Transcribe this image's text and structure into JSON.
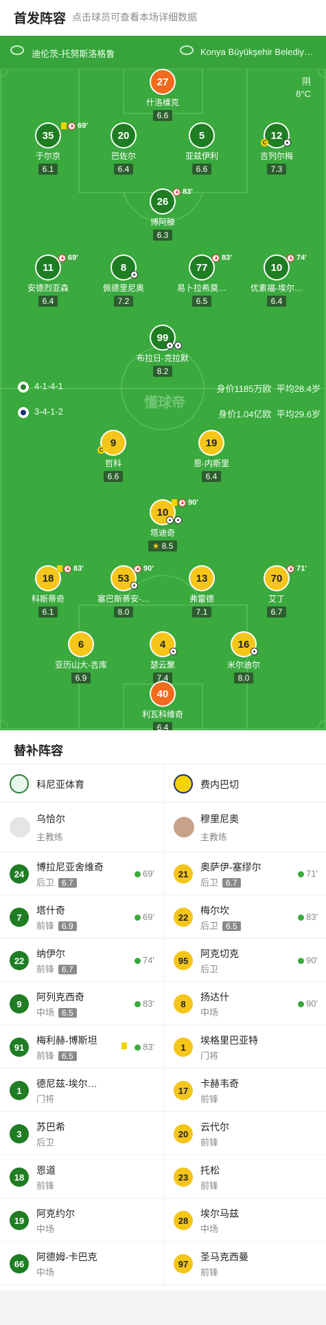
{
  "header": {
    "title": "首发阵容",
    "subtitle": "点击球员可查看本场详细数据"
  },
  "teams": {
    "home": "迪伦茨-托努斯洛格鲁",
    "away": "Konya Büyükşehir Belediy…"
  },
  "weather": {
    "condition": "阴",
    "temp": "8°C"
  },
  "watermark": "懂球帝",
  "home_form": {
    "formation": "4-1-4-1",
    "value": "身价1185万欧",
    "age": "平均28.4岁"
  },
  "away_form": {
    "formation": "3-4-1-2",
    "value": "身价1.04亿欧",
    "age": "平均29.6岁"
  },
  "home_players": [
    {
      "num": "27",
      "name": "什洛维克",
      "rating": "6.6"
    },
    {
      "num": "35",
      "name": "于尔京",
      "rating": "6.1",
      "min": "69'"
    },
    {
      "num": "20",
      "name": "巴佐尔",
      "rating": "6.4"
    },
    {
      "num": "5",
      "name": "亚兹伊利",
      "rating": "6.6"
    },
    {
      "num": "12",
      "name": "吉列尔梅",
      "rating": "7.3"
    },
    {
      "num": "26",
      "name": "博阿滕",
      "rating": "6.3",
      "min": "83'"
    },
    {
      "num": "11",
      "name": "安德烈亚森",
      "rating": "6.4",
      "min": "69'"
    },
    {
      "num": "8",
      "name": "佩德里尼奥",
      "rating": "7.2"
    },
    {
      "num": "77",
      "name": "易卜拉希莫…",
      "rating": "6.5",
      "min": "83'"
    },
    {
      "num": "10",
      "name": "优素福-埃尔…",
      "rating": "6.4",
      "min": "74'"
    },
    {
      "num": "99",
      "name": "布拉日-克拉默",
      "rating": "8.2"
    }
  ],
  "away_players": [
    {
      "num": "9",
      "name": "哲科",
      "rating": "6.6"
    },
    {
      "num": "19",
      "name": "恩-内斯里",
      "rating": "6.4"
    },
    {
      "num": "10",
      "name": "塔迪奇",
      "rating": "8.5",
      "min": "90'"
    },
    {
      "num": "18",
      "name": "科斯蒂奇",
      "rating": "6.1",
      "min": "83'"
    },
    {
      "num": "53",
      "name": "塞巴斯蒂安-…",
      "rating": "8.0",
      "min": "90'"
    },
    {
      "num": "13",
      "name": "弗雷德",
      "rating": "7.1"
    },
    {
      "num": "70",
      "name": "艾丁",
      "rating": "6.7",
      "min": "71'"
    },
    {
      "num": "6",
      "name": "亚历山大-吉库",
      "rating": "6.9"
    },
    {
      "num": "4",
      "name": "瑟云聚",
      "rating": "7.4"
    },
    {
      "num": "16",
      "name": "米尔迪尔",
      "rating": "8.0"
    },
    {
      "num": "40",
      "name": "利瓦科维奇",
      "rating": "6.4"
    }
  ],
  "subs_title": "替补阵容",
  "home_subs": {
    "team": "科尼亚体育",
    "coach": {
      "name": "乌恰尔",
      "role": "主教练"
    },
    "players": [
      {
        "num": "24",
        "name": "博拉尼亚舍维奇",
        "pos": "后卫",
        "rating": "6.7",
        "min": "69'"
      },
      {
        "num": "7",
        "name": "塔什奇",
        "pos": "前锋",
        "rating": "6.9",
        "min": "69'"
      },
      {
        "num": "22",
        "name": "纳伊尔",
        "pos": "前锋",
        "rating": "6.7",
        "min": "74'"
      },
      {
        "num": "9",
        "name": "阿列克西奇",
        "pos": "中场",
        "rating": "6.5",
        "min": "83'"
      },
      {
        "num": "91",
        "name": "梅利赫-博斯坦",
        "pos": "前锋",
        "rating": "6.5",
        "min": "83'"
      },
      {
        "num": "1",
        "name": "德尼兹-埃尔…",
        "pos": "门将"
      },
      {
        "num": "3",
        "name": "苏巴希",
        "pos": "后卫"
      },
      {
        "num": "18",
        "name": "恩道",
        "pos": "前锋"
      },
      {
        "num": "19",
        "name": "阿克约尔",
        "pos": "中场"
      },
      {
        "num": "66",
        "name": "阿德姆-卡巴克",
        "pos": "中场"
      }
    ]
  },
  "away_subs": {
    "team": "费内巴切",
    "coach": {
      "name": "穆里尼奥",
      "role": "主教练"
    },
    "players": [
      {
        "num": "21",
        "name": "奥萨伊-塞缪尔",
        "pos": "后卫",
        "rating": "6.7",
        "min": "71'"
      },
      {
        "num": "22",
        "name": "梅尔坎",
        "pos": "后卫",
        "rating": "6.5",
        "min": "83'"
      },
      {
        "num": "95",
        "name": "阿克切克",
        "pos": "后卫",
        "min": "90'"
      },
      {
        "num": "8",
        "name": "扬达什",
        "pos": "中场",
        "min": "90'"
      },
      {
        "num": "1",
        "name": "埃格里巴亚特",
        "pos": "门将"
      },
      {
        "num": "17",
        "name": "卡赫韦奇",
        "pos": "前锋"
      },
      {
        "num": "20",
        "name": "云代尔",
        "pos": "前锋"
      },
      {
        "num": "23",
        "name": "托松",
        "pos": "前锋"
      },
      {
        "num": "28",
        "name": "埃尔马兹",
        "pos": "中场"
      },
      {
        "num": "97",
        "name": "圣马克西曼",
        "pos": "前锋"
      }
    ]
  }
}
